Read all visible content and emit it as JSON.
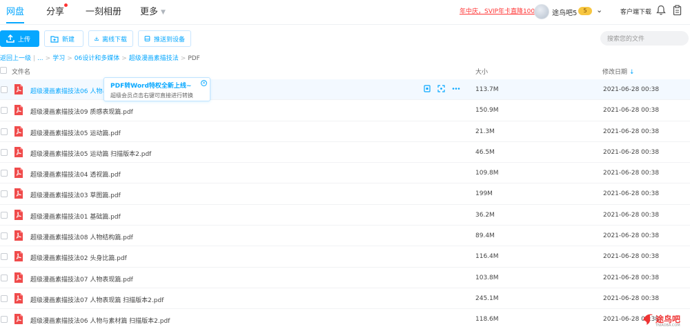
{
  "nav": {
    "tabs": [
      {
        "label": "网盘",
        "active": true
      },
      {
        "label": "分享",
        "has_dot": true
      },
      {
        "label": "一刻相册"
      },
      {
        "label": "更多",
        "has_chevron": true
      }
    ],
    "promo": "年中庆，SVIP年卡直降100",
    "username": "途鸟吧5",
    "vip_badge": "5",
    "client_download": "客户端下载"
  },
  "toolbar": {
    "upload": "上传",
    "new_folder": "新建",
    "offline_download": "离线下载",
    "push_device": "推送到设备",
    "search_placeholder": "搜索您的文件"
  },
  "breadcrumb": {
    "back": "返回上一级",
    "ellipsis": "...",
    "items": [
      "学习",
      "06设计和多媒体",
      "超级漫画素描技法"
    ],
    "current": "PDF"
  },
  "table": {
    "headers": {
      "name": "文件名",
      "size": "大小",
      "date": "修改日期"
    },
    "sort_arrow": "↓"
  },
  "tooltip": {
    "title": "PDF转Word特权全新上线~",
    "subtitle": "超级会员点击右键可直接进行转换"
  },
  "files": [
    {
      "name": "超级漫画素描技法06 人物与素材篇.pdf",
      "size": "113.7M",
      "date": "2021-06-28 00:38",
      "hover": true
    },
    {
      "name": "超级漫画素描技法09 质感表现篇.pdf",
      "size": "150.9M",
      "date": "2021-06-28 00:38"
    },
    {
      "name": "超级漫画素描技法05 运动篇.pdf",
      "size": "21.3M",
      "date": "2021-06-28 00:38"
    },
    {
      "name": "超级漫画素描技法05 运动篇 扫描版本2.pdf",
      "size": "46.5M",
      "date": "2021-06-28 00:38"
    },
    {
      "name": "超级漫画素描技法04 透视篇.pdf",
      "size": "109.8M",
      "date": "2021-06-28 00:38"
    },
    {
      "name": "超级漫画素描技法03 草图篇.pdf",
      "size": "199M",
      "date": "2021-06-28 00:38"
    },
    {
      "name": "超级漫画素描技法01 基础篇.pdf",
      "size": "36.2M",
      "date": "2021-06-28 00:38"
    },
    {
      "name": "超级漫画素描技法08 人物结构篇.pdf",
      "size": "89.4M",
      "date": "2021-06-28 00:38"
    },
    {
      "name": "超级漫画素描技法02 头身比篇.pdf",
      "size": "116.4M",
      "date": "2021-06-28 00:38"
    },
    {
      "name": "超级漫画素描技法07 人物表现篇.pdf",
      "size": "103.8M",
      "date": "2021-06-28 00:38"
    },
    {
      "name": "超级漫画素描技法07 人物表现篇 扫描版本2.pdf",
      "size": "245.1M",
      "date": "2021-06-28 00:38"
    },
    {
      "name": "超级漫画素描技法06 人物与素材篇 扫描版本2.pdf",
      "size": "118.6M",
      "date": "2021-06-28 00:38"
    }
  ],
  "watermark": {
    "text": "途鸟吧",
    "sub": "TNIAOBA.COM"
  },
  "colors": {
    "accent": "#06a7ff",
    "promo": "#ff3333",
    "pdf_icon": "#f04b4b"
  }
}
